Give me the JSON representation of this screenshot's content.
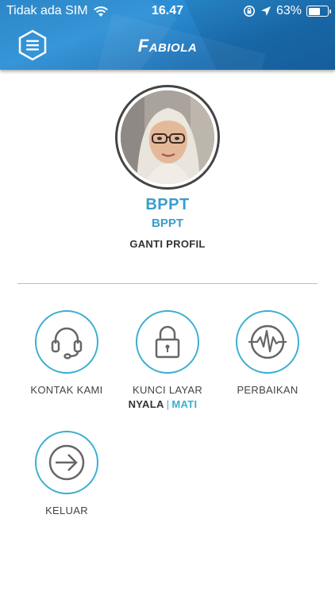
{
  "status": {
    "carrier": "Tidak ada SIM",
    "time": "16.47",
    "battery": "63%",
    "battery_level": 0.63
  },
  "header": {
    "brand_initial": "F",
    "brand_rest": "ABIOLA"
  },
  "profile": {
    "name": "BPPT",
    "organization": "BPPT",
    "change_label": "GANTI PROFIL"
  },
  "actions": {
    "contact": "KONTAK KAMI",
    "lock": "KUNCI LAYAR",
    "repair": "PERBAIKAN",
    "logout": "KELUAR"
  },
  "lock_toggle": {
    "on": "NYALA",
    "separator": "|",
    "off": "MATI"
  },
  "colors": {
    "accent": "#3aaed0",
    "header": "#1f7fc4",
    "name_text": "#3a9ec9"
  }
}
